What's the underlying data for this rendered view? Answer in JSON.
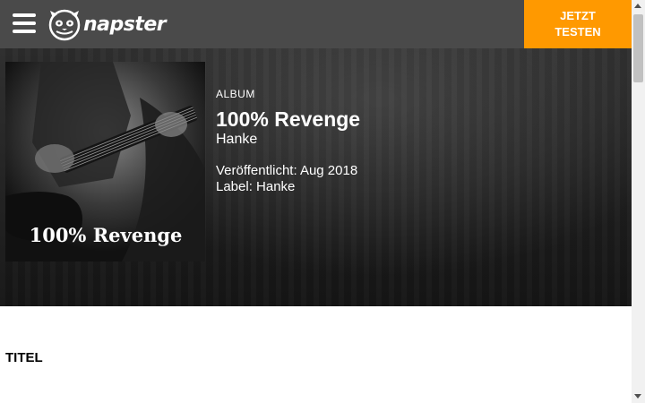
{
  "header": {
    "menu_icon": "hamburger-icon",
    "logo_icon": "napster-cat-logo-icon",
    "logo_text": "napster",
    "cta_line1": "JETZT",
    "cta_line2": "TESTEN",
    "cta_color": "#ff9900",
    "bar_color": "#4a4a4a"
  },
  "album": {
    "kicker": "ALBUM",
    "title": "100% Revenge",
    "artist": "Hanke",
    "released": "Veröffentlicht: Aug 2018",
    "label": "Label: Hanke",
    "cover_text": "100% Revenge"
  },
  "tracks": {
    "section_title": "TITEL"
  }
}
